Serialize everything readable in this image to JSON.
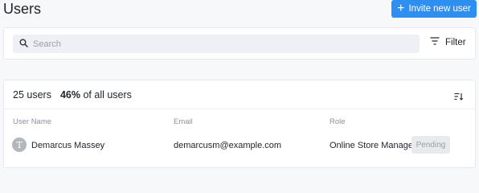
{
  "header": {
    "title": "Users",
    "invite_label": "Invite new user"
  },
  "search": {
    "placeholder": "Search",
    "value": "",
    "filter_label": "Filter"
  },
  "summary": {
    "count_text": "25 users",
    "percent_text": "46%",
    "percent_suffix": "of all users"
  },
  "table": {
    "columns": [
      "User Name",
      "Email",
      "Role"
    ],
    "rows": [
      {
        "avatar_initial": "T",
        "name": "Demarcus Massey",
        "email": "demarcusm@example.com",
        "role": "Online Store Manager",
        "status": "Pending"
      }
    ]
  },
  "colors": {
    "accent": "#2e8ff0",
    "avatar": "#b3b6bb"
  }
}
